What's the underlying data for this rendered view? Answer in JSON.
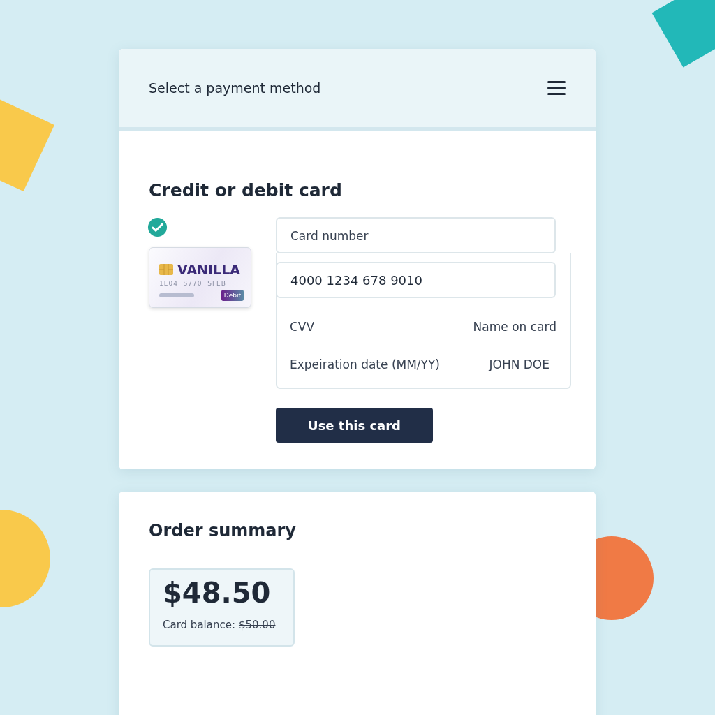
{
  "header": {
    "title": "Select a payment method"
  },
  "payment": {
    "title": "Credit or debit card",
    "saved_card": {
      "selected": true,
      "brand": "VANILLA",
      "number": "1E04  S770  SFEB",
      "tag": "Debit"
    },
    "fields": [
      {
        "kind": "input",
        "placeholder": "Card number"
      },
      {
        "kind": "input",
        "value": "4000 1234 678 9010"
      }
    ],
    "rows": [
      {
        "left": "CVV",
        "right": "Name on card"
      },
      {
        "left": "Expeiration date (MM/YY)",
        "right": "JOHN DOE"
      }
    ],
    "button": "Use this card"
  },
  "order_summary": {
    "title": "Order summary",
    "amount": "$48.50",
    "balance_label": "Card balance:",
    "balance_value": "$50.00"
  }
}
